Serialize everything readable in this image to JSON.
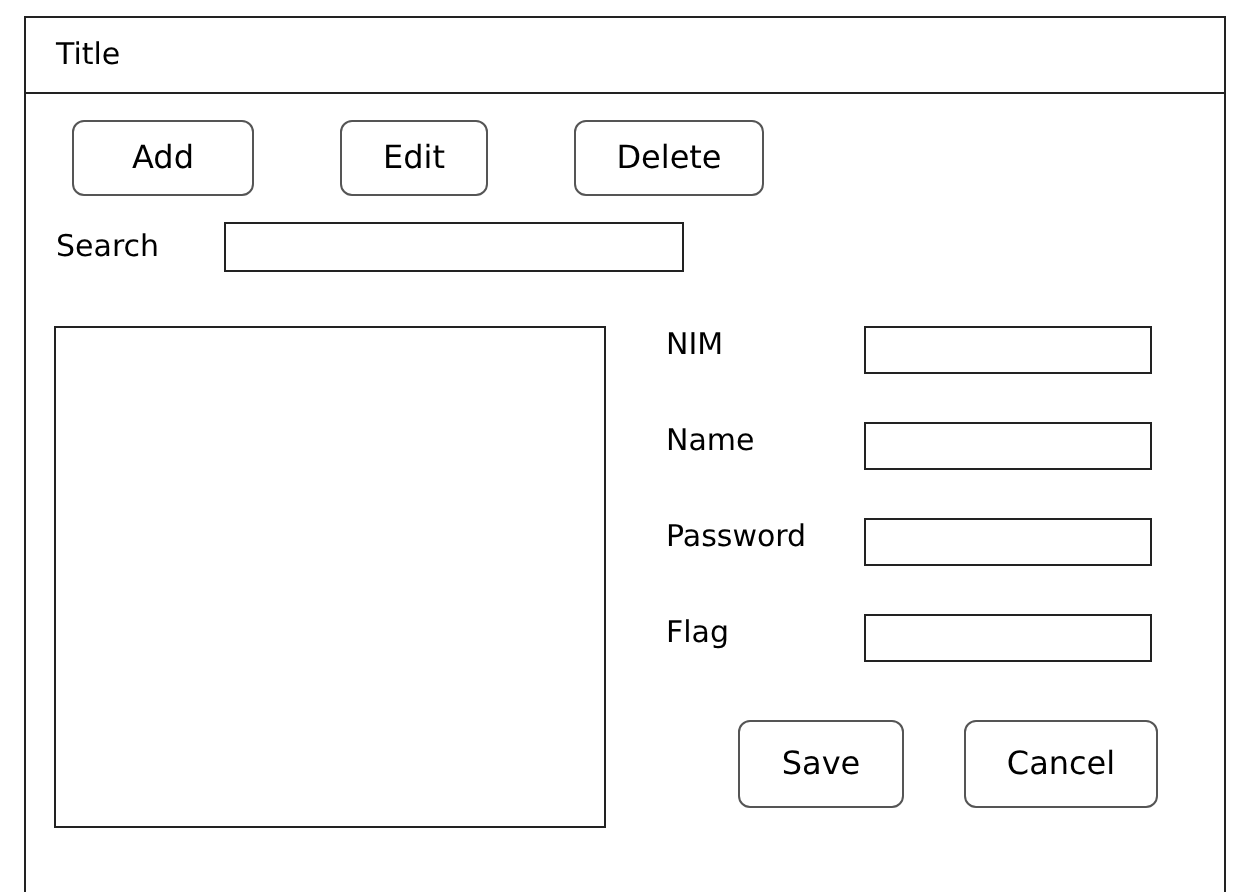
{
  "window": {
    "title": "Title"
  },
  "toolbar": [
    "Add",
    "Edit",
    "Delete"
  ],
  "search": {
    "label": "Search"
  },
  "form": {
    "fields": [
      {
        "label": "NIM"
      },
      {
        "label": "Name"
      },
      {
        "label": "Password"
      },
      {
        "label": "Flag"
      }
    ],
    "buttons": [
      "Save",
      "Cancel"
    ]
  }
}
